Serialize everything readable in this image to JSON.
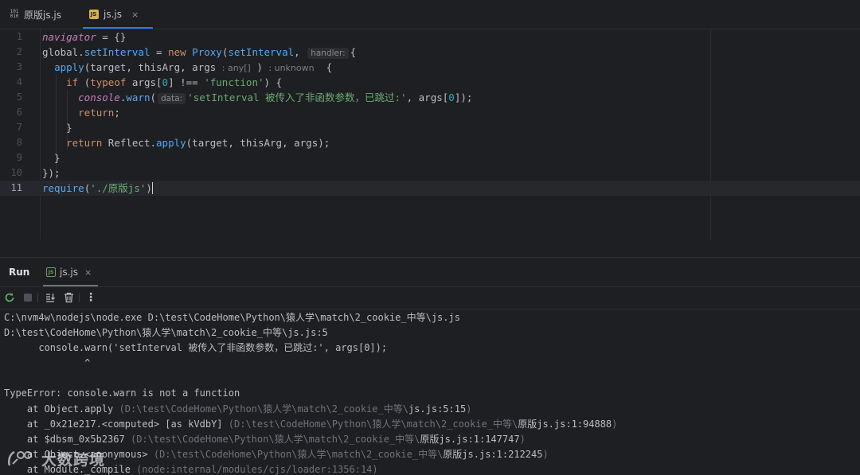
{
  "editor_tabs": [
    {
      "label": "原版js.js",
      "icon": "binary-file-icon"
    },
    {
      "label": "js.js",
      "icon": "javascript-file-icon",
      "active": true,
      "close": "×"
    }
  ],
  "code": {
    "line_numbers": [
      "1",
      "2",
      "3",
      "4",
      "5",
      "6",
      "7",
      "8",
      "9",
      "10",
      "11"
    ],
    "current_line": "11",
    "hints": {
      "handler": "handler:",
      "any_type": ": any[]",
      "unknown_ret": ": unknown",
      "data": "data:"
    },
    "l1": {
      "var": "navigator",
      "rest": " = {}"
    },
    "l2": {
      "obj": "global",
      "dot": ".",
      "prop": "setInterval",
      "eq": " = ",
      "new": "new ",
      "cls": "Proxy",
      "open": "(",
      "arg": "setInterval",
      "comma": ", ",
      "brace": "{"
    },
    "l3": {
      "indent": "  ",
      "fn": "apply",
      "params": "(target, thisArg, args ",
      "close": ")",
      "brace": " {"
    },
    "l4": {
      "indent": "    ",
      "if": "if ",
      "paren": "(",
      "typeof": "typeof ",
      "expr": "args[",
      "idx": "0",
      "cmp": "] !== ",
      "str": "'function'",
      "end": ") {"
    },
    "l5": {
      "indent": "      ",
      "obj": "console",
      "dot": ".",
      "fn": "warn",
      "open": "(",
      "str": "'setInterval 被传入了非函数参数，已跳过:'",
      "mid": ", args[",
      "idx": "0",
      "end": "]);"
    },
    "l6": {
      "indent": "      ",
      "kw": "return",
      "end": ";"
    },
    "l7": {
      "text": "    }"
    },
    "l8": {
      "indent": "    ",
      "kw": "return ",
      "obj": "Reflect.",
      "fn": "apply",
      "end": "(target, thisArg, args);"
    },
    "l9": {
      "text": "  }"
    },
    "l10": {
      "text": "});"
    },
    "l11": {
      "fn": "require",
      "open": "(",
      "str": "'./原版js'",
      "close": ")"
    }
  },
  "run_panel": {
    "title": "Run",
    "tab_label": "js.js",
    "tab_close": "×",
    "toolbar": {
      "rerun": "rerun-icon",
      "stop": "stop-icon",
      "scroll_end": "scroll-to-end-icon",
      "clear": "trash-icon",
      "more": "⋮"
    }
  },
  "console": {
    "cmd": "C:\\nvm4w\\nodejs\\node.exe D:\\test\\CodeHome\\Python\\猿人学\\match\\2_cookie_中等\\js.js",
    "file_loc": "D:\\test\\CodeHome\\Python\\猿人学\\match\\2_cookie_中等\\js.js:5",
    "src_line": "      console.warn('setInterval 被传入了非函数参数，已跳过:', args[0]);",
    "caret": "              ^",
    "error": "TypeError: console.warn is not a function",
    "stack": [
      {
        "pre": "    at Object.apply ",
        "open": "(",
        "loc": "D:\\test\\CodeHome\\Python\\猿人学\\match\\2_cookie_中等\\",
        "link": "js.js:5:15",
        "close": ")"
      },
      {
        "pre": "    at _0x21e217.<computed> [as kVdbY] ",
        "open": "(",
        "loc": "D:\\test\\CodeHome\\Python\\猿人学\\match\\2_cookie_中等\\",
        "link": "原版js.js:1:94888",
        "close": ")"
      },
      {
        "pre": "    at $dbsm_0x5b2367 ",
        "open": "(",
        "loc": "D:\\test\\CodeHome\\Python\\猿人学\\match\\2_cookie_中等\\",
        "link": "原版js.js:1:147747",
        "close": ")"
      },
      {
        "pre": "    at Object.<anonymous> ",
        "open": "(",
        "loc": "D:\\test\\CodeHome\\Python\\猿人学\\match\\2_cookie_中等\\",
        "link": "原版js.js:1:212245",
        "close": ")"
      },
      {
        "pre": "    at Module._compile ",
        "open": "(",
        "loc": "node:internal/modules/cjs/loader:1356:14",
        "link": "",
        "close": ")"
      }
    ]
  },
  "watermark": {
    "text": "大数跨境"
  }
}
